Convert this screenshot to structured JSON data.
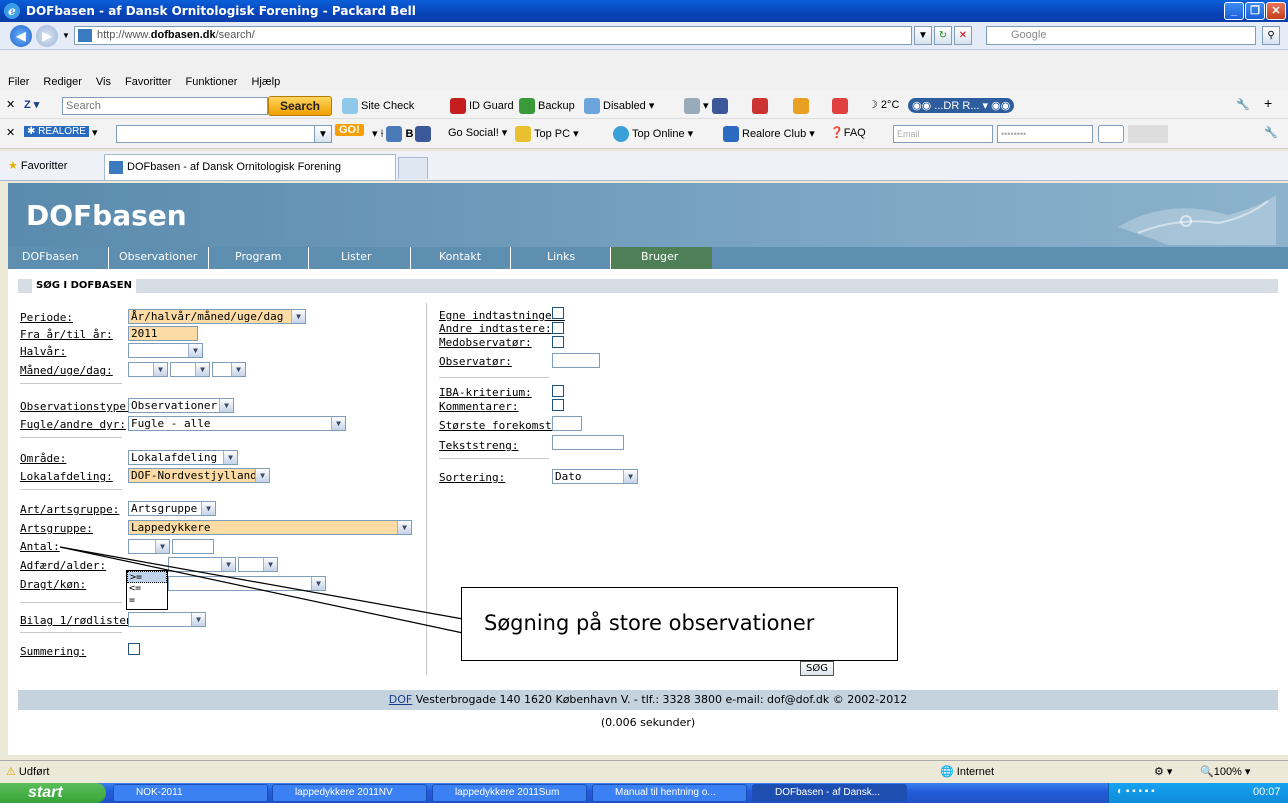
{
  "window": {
    "title": "DOFbasen - af Dansk Ornitologisk Forening - Packard Bell"
  },
  "browser": {
    "address_prefix": "http://www.",
    "address_domain": "dofbasen.dk",
    "address_path": "/search/",
    "search_placeholder": "Google",
    "menu": [
      "Filer",
      "Rediger",
      "Vis",
      "Favoritter",
      "Funktioner",
      "Hjælp"
    ],
    "toolbar1": {
      "search_placeholder": "Search",
      "search_button": "Search",
      "items": [
        "Site Check",
        "ID Guard",
        "Backup",
        "Disabled",
        "2°C",
        "...DR R..."
      ]
    },
    "toolbar2": {
      "logo": "REALORE",
      "go": "GO!",
      "items": [
        "Go Social!",
        "Top PC",
        "Top Online",
        "Realore Club",
        "FAQ"
      ],
      "email_placeholder": "Email",
      "password_mask": "••••••••"
    },
    "favorites_label": "Favoritter",
    "tab_title": "DOFbasen - af Dansk Ornitologisk Forening"
  },
  "site": {
    "title": "DOFbasen",
    "nav": [
      "DOFbasen",
      "Observationer",
      "Program",
      "Lister",
      "Kontakt",
      "Links",
      "Bruger"
    ],
    "section_title": "SØG I DOFBASEN"
  },
  "form": {
    "periode_label": "Periode:",
    "periode_value": "År/halvår/måned/uge/dag",
    "fra_label": "Fra år/til år:",
    "fra_value": "2011",
    "halvaar_label": "Halvår:",
    "maaned_label": "Måned/uge/dag:",
    "obstype_label": "Observationstype:",
    "obstype_value": "Observationer",
    "fugle_label": "Fugle/andre dyr:",
    "fugle_value": "Fugle - alle",
    "omraade_label": "Område:",
    "omraade_value": "Lokalafdeling",
    "lokal_label": "Lokalafdeling:",
    "lokal_value": "DOF-Nordvestjylland",
    "art_label": "Art/artsgruppe:",
    "art_value": "Artsgruppe",
    "artsgruppe_label": "Artsgruppe:",
    "artsgruppe_value": "Lappedykkere",
    "antal_label": "Antal:",
    "adfaerd_label": "Adfærd/alder:",
    "dragt_label": "Dragt/køn:",
    "bilag_label": "Bilag 1/rødlisten:",
    "summering_label": "Summering:",
    "antal_options": [
      ">=",
      "<=",
      "="
    ],
    "egne_label": "Egne indtastninger:",
    "andre_label": "Andre indtastere:",
    "medobs_label": "Medobservatør:",
    "observatoer_label": "Observatør:",
    "iba_label": "IBA-kriterium:",
    "kommentarer_label": "Kommentarer:",
    "stoerste_label": "Største forekomst:",
    "tekst_label": "Tekststreng:",
    "sortering_label": "Sortering:",
    "sortering_value": "Dato",
    "submit": "SØG"
  },
  "annotation": {
    "callout_text": "Søgning på store observationer"
  },
  "footer": {
    "link": "DOF",
    "text": " Vesterbrogade 140 1620 København V. - tlf.: 3328 3800 e-mail: dof@dof.dk © 2002-2012",
    "timing": "(0.006 sekunder)"
  },
  "status": {
    "left": "Udført",
    "zone": "Internet",
    "zoom": "100%"
  },
  "taskbar": {
    "start": "start",
    "tasks": [
      "NOK-2011",
      "lappedykkere 2011NV",
      "lappedykkere 2011Sum",
      "Manual til hentning o...",
      "DOFbasen - af Dansk..."
    ],
    "clock": "00:07"
  },
  "colors": {
    "highlight_field": "#fcdca4",
    "banner": "#6a98b8",
    "nav_active": "#4f7f56"
  }
}
